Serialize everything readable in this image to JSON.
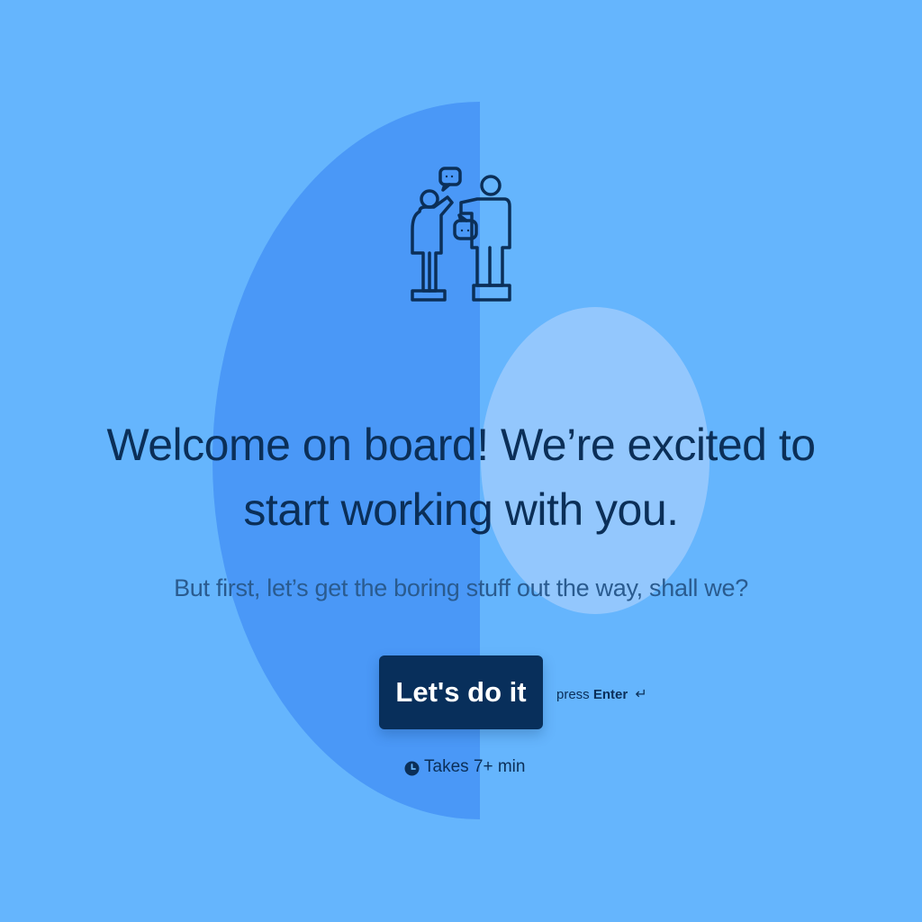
{
  "welcome": {
    "headline": "Welcome on board! We’re excited to start working with you.",
    "subtitle": "But first, let’s get the boring stuff out the way, shall we?",
    "cta_label": "Let's do it",
    "press_prefix": "press",
    "press_key": "Enter",
    "press_icon": "↵",
    "time_estimate": "Takes 7+ min"
  },
  "icons": {
    "illustration": "team-collaboration-icon",
    "enter": "enter-key-icon",
    "clock": "clock-icon"
  },
  "colors": {
    "background": "#65b5fd",
    "shape_half": "#4a98f7",
    "shape_ellipse": "#93c7fd",
    "text_dark": "#0b2f58",
    "button": "#082f5b",
    "button_text": "#ffffff"
  }
}
